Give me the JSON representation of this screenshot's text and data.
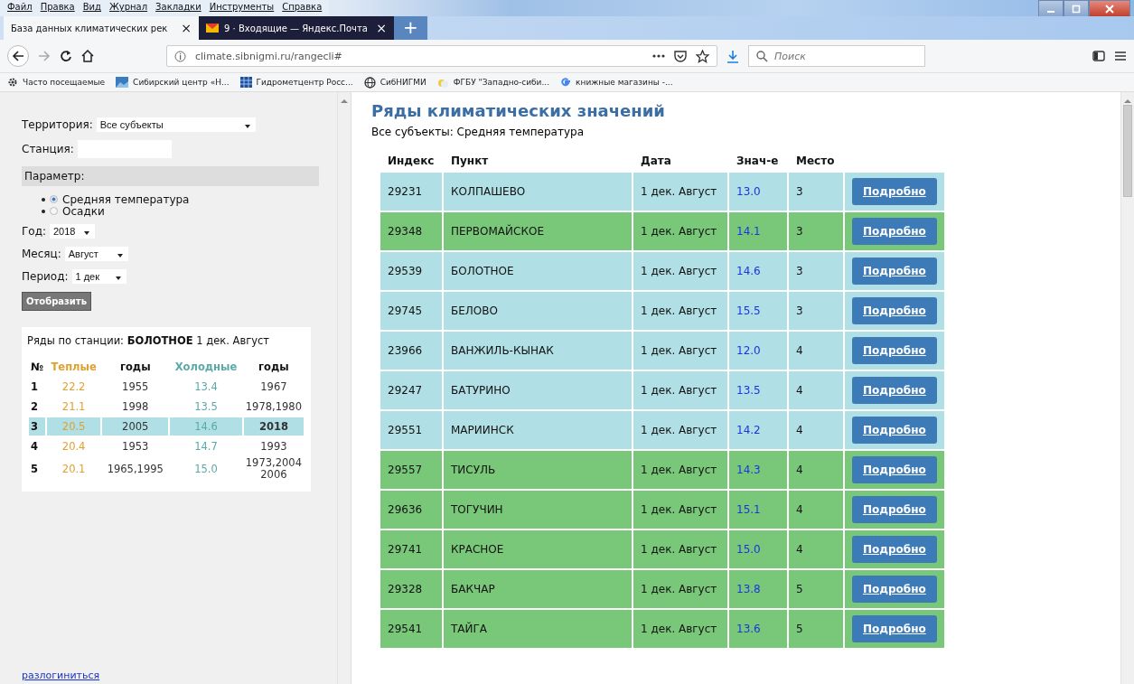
{
  "menu_bar": [
    "Файл",
    "Правка",
    "Вид",
    "Журнал",
    "Закладки",
    "Инструменты",
    "Справка"
  ],
  "tabs": [
    {
      "label": "База данных климатических рек",
      "close": "×",
      "selected": true
    },
    {
      "label": "9 · Входящие — Яндекс.Почта",
      "close": "×",
      "selected": false
    }
  ],
  "new_tab": "+",
  "address_bar": {
    "url": "climate.sibnigmi.ru/rangecli#"
  },
  "search": {
    "placeholder": "Поиск"
  },
  "bookmarks": [
    {
      "label": "Часто посещаемые",
      "kind": "gear"
    },
    {
      "label": "Сибирский центр «Н...",
      "kind": "site"
    },
    {
      "label": "Гидрометцентр Росс...",
      "kind": "grid"
    },
    {
      "label": "СибНИГМИ",
      "kind": "globe"
    },
    {
      "label": "ФГБУ \"Западно-сиби...",
      "kind": "sun"
    },
    {
      "label": "книжные магазины -...",
      "kind": "g"
    }
  ],
  "sidebar": {
    "territory": {
      "label": "Территория:",
      "value": "Все субъекты"
    },
    "station": {
      "label": "Станция:"
    },
    "parameter": {
      "title": "Параметр:",
      "options": [
        {
          "label": "Средняя температура",
          "selected": true
        },
        {
          "label": "Осадки",
          "selected": false
        }
      ]
    },
    "year": {
      "label": "Год:",
      "value": "2018"
    },
    "month": {
      "label": "Месяц:",
      "value": "Август"
    },
    "period": {
      "label": "Период:",
      "value": "1 дек"
    },
    "show_button": "Отобразить",
    "series": {
      "title": "Ряды по станции: **БОЛОТНОЕ** 1 дек. Август",
      "columns": [
        {
          "label": "№",
          "kind": "plain"
        },
        {
          "label": "Теплые",
          "kind": "warm"
        },
        {
          "label": "годы",
          "kind": "plain"
        },
        {
          "label": "Холодные",
          "kind": "cold"
        },
        {
          "label": "годы",
          "kind": "plain"
        }
      ],
      "rows": [
        {
          "n": "1",
          "warm": "22.2",
          "warm_years": "1955",
          "cold": "13.4",
          "cold_years": "1967",
          "selected": false
        },
        {
          "n": "2",
          "warm": "21.1",
          "warm_years": "1998",
          "cold": "13.5",
          "cold_years": "1978,1980",
          "selected": false
        },
        {
          "n": "3",
          "warm": "20.5",
          "warm_years": "2005",
          "cold": "14.6",
          "cold_years": "2018",
          "selected": true
        },
        {
          "n": "4",
          "warm": "20.4",
          "warm_years": "1953",
          "cold": "14.7",
          "cold_years": "1993",
          "selected": false
        },
        {
          "n": "5",
          "warm": "20.1",
          "warm_years": "1965,1995",
          "cold": "15.0",
          "cold_years": "1973,2004 2006",
          "selected": false
        }
      ]
    },
    "logout_link": "разлогиниться"
  },
  "main": {
    "title": "Ряды климатических значений",
    "subtitle": "Все субъекты: Средняя температура",
    "columns": [
      "Индекс",
      "Пункт",
      "Дата",
      "Знач-е",
      "Место"
    ],
    "rows": [
      {
        "index": "29231",
        "place": "КОЛПАШЕВО",
        "date": "1 дек. Август",
        "value": "13.0",
        "rank": "3",
        "button": "Подробно",
        "color": "#b0dfe5"
      },
      {
        "index": "29348",
        "place": "ПЕРВОМАЙСКОЕ",
        "date": "1 дек. Август",
        "value": "14.1",
        "rank": "3",
        "button": "Подробно",
        "color": "#79c879"
      },
      {
        "index": "29539",
        "place": "БОЛОТНОЕ",
        "date": "1 дек. Август",
        "value": "14.6",
        "rank": "3",
        "button": "Подробно",
        "color": "#b0dfe5"
      },
      {
        "index": "29745",
        "place": "БЕЛОВО",
        "date": "1 дек. Август",
        "value": "15.5",
        "rank": "3",
        "button": "Подробно",
        "color": "#b0dfe5"
      },
      {
        "index": "23966",
        "place": "ВАНЖИЛЬ-КЫНАК",
        "date": "1 дек. Август",
        "value": "12.0",
        "rank": "4",
        "button": "Подробно",
        "color": "#b0dfe5"
      },
      {
        "index": "29247",
        "place": "БАТУРИНО",
        "date": "1 дек. Август",
        "value": "13.5",
        "rank": "4",
        "button": "Подробно",
        "color": "#b0dfe5"
      },
      {
        "index": "29551",
        "place": "МАРИИНСК",
        "date": "1 дек. Август",
        "value": "14.2",
        "rank": "4",
        "button": "Подробно",
        "color": "#b0dfe5"
      },
      {
        "index": "29557",
        "place": "ТИСУЛЬ",
        "date": "1 дек. Август",
        "value": "14.3",
        "rank": "4",
        "button": "Подробно",
        "color": "#79c879"
      },
      {
        "index": "29636",
        "place": "ТОГУЧИН",
        "date": "1 дек. Август",
        "value": "15.1",
        "rank": "4",
        "button": "Подробно",
        "color": "#79c879"
      },
      {
        "index": "29741",
        "place": "КРАСНОЕ",
        "date": "1 дек. Август",
        "value": "15.0",
        "rank": "4",
        "button": "Подробно",
        "color": "#79c879"
      },
      {
        "index": "29328",
        "place": "БАКЧАР",
        "date": "1 дек. Август",
        "value": "13.8",
        "rank": "5",
        "button": "Подробно",
        "color": "#79c879"
      },
      {
        "index": "29541",
        "place": "ТАЙГА",
        "date": "1 дек. Август",
        "value": "13.6",
        "rank": "5",
        "button": "Подробно",
        "color": "#79c879"
      }
    ]
  }
}
